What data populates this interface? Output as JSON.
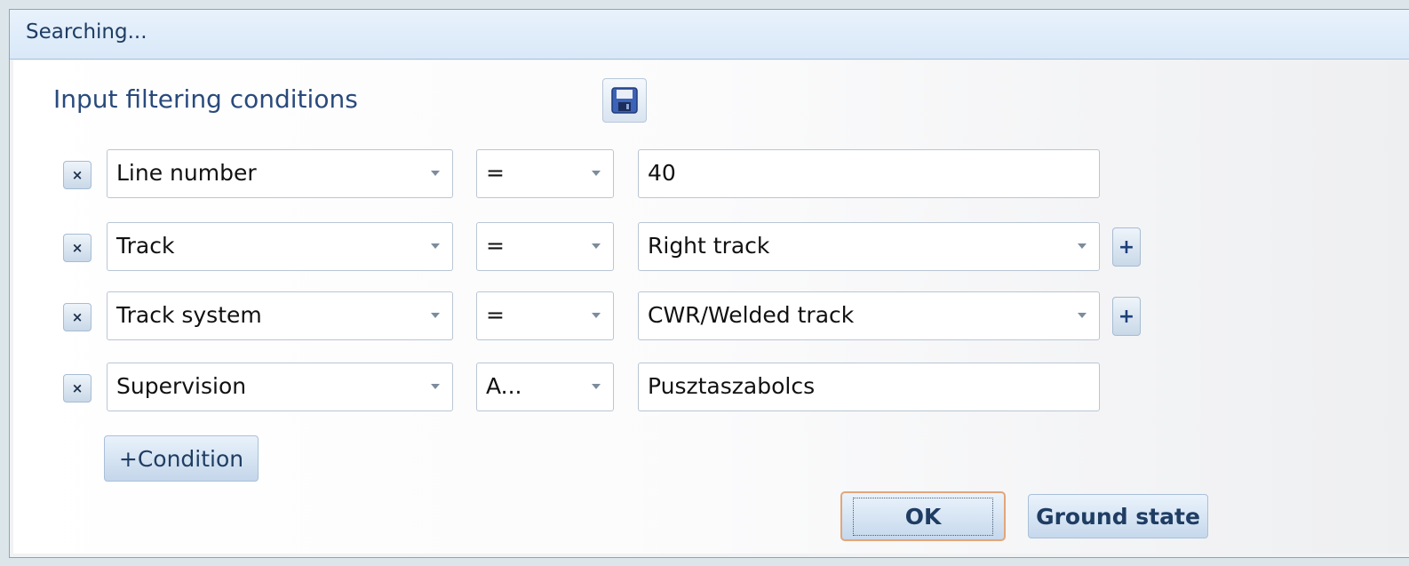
{
  "window": {
    "title": "Searching..."
  },
  "form": {
    "heading": "Input filtering conditions",
    "save_icon": "floppy-disk-icon",
    "remove_icon_glyph": "×",
    "add_value_glyph": "+",
    "conditions": [
      {
        "field": "Line number",
        "operator": "=",
        "value": "40",
        "value_type": "text"
      },
      {
        "field": "Track",
        "operator": "=",
        "value": "Right track",
        "value_type": "dropdown"
      },
      {
        "field": "Track system",
        "operator": "=",
        "value": "CWR/Welded track",
        "value_type": "dropdown"
      },
      {
        "field": "Supervision",
        "operator": "A...",
        "value": "Pusztaszabolcs",
        "value_type": "text"
      }
    ],
    "add_condition_label": "+Condition"
  },
  "actions": {
    "ok_label": "OK",
    "ground_state_label": "Ground state"
  },
  "colors": {
    "title_text": "#1f3d63",
    "heading_text": "#2a4a7c",
    "focus_border": "#e3a579"
  }
}
